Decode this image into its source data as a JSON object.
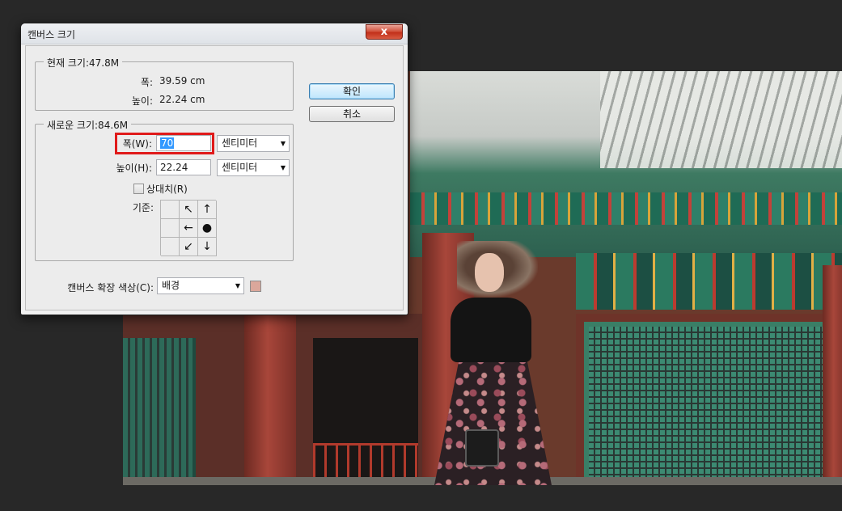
{
  "dialog": {
    "title": "캔버스 크기",
    "close_label": "x",
    "ok_label": "확인",
    "cancel_label": "취소"
  },
  "current_size": {
    "title": "현재 크기:47.8M",
    "width_label": "폭:",
    "width_value": "39.59 cm",
    "height_label": "높이:",
    "height_value": "22.24 cm"
  },
  "new_size": {
    "title": "새로운 크기:84.6M",
    "width_label": "폭(W):",
    "width_value": "70",
    "width_unit": "센티미터",
    "height_label": "높이(H):",
    "height_value": "22.24",
    "height_unit": "센티미터",
    "relative_label": "상대치(R)",
    "anchor_label": "기준:"
  },
  "extension_color": {
    "label": "캔버스 확장 색상(C):",
    "value": "배경",
    "swatch_color": "#dba79b"
  },
  "anchor_arrows": [
    "↖",
    "↑",
    "",
    "←",
    "●",
    "",
    "↙",
    "↓",
    ""
  ]
}
